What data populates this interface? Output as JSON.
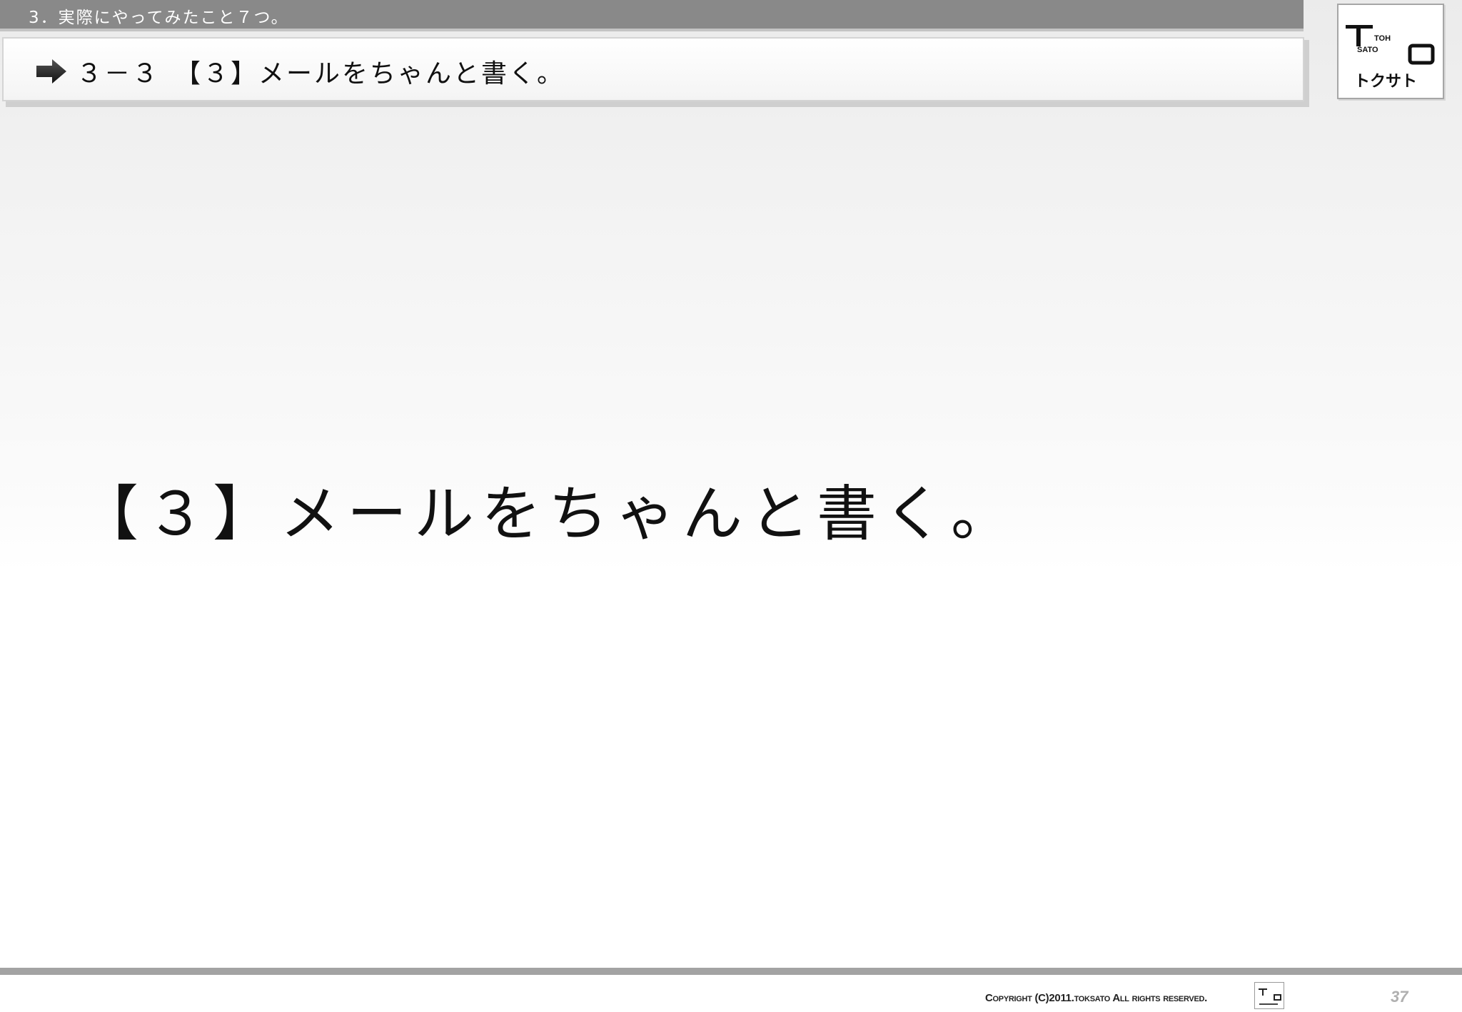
{
  "header": {
    "section_label": "3．実際にやってみたこと７つ。",
    "heading": "３－３　【３】メールをちゃんと書く。"
  },
  "logo": {
    "line1": "TOH",
    "line2": "SATO",
    "katakana": "トクサト"
  },
  "main": {
    "title": "【３】メールをちゃんと書く。"
  },
  "footer": {
    "copyright": "Copyright (C)2011.toksato All rights reserved.",
    "page_number": "37"
  },
  "colors": {
    "top_bar": "#898989",
    "footer_line": "#a3a3a3"
  }
}
